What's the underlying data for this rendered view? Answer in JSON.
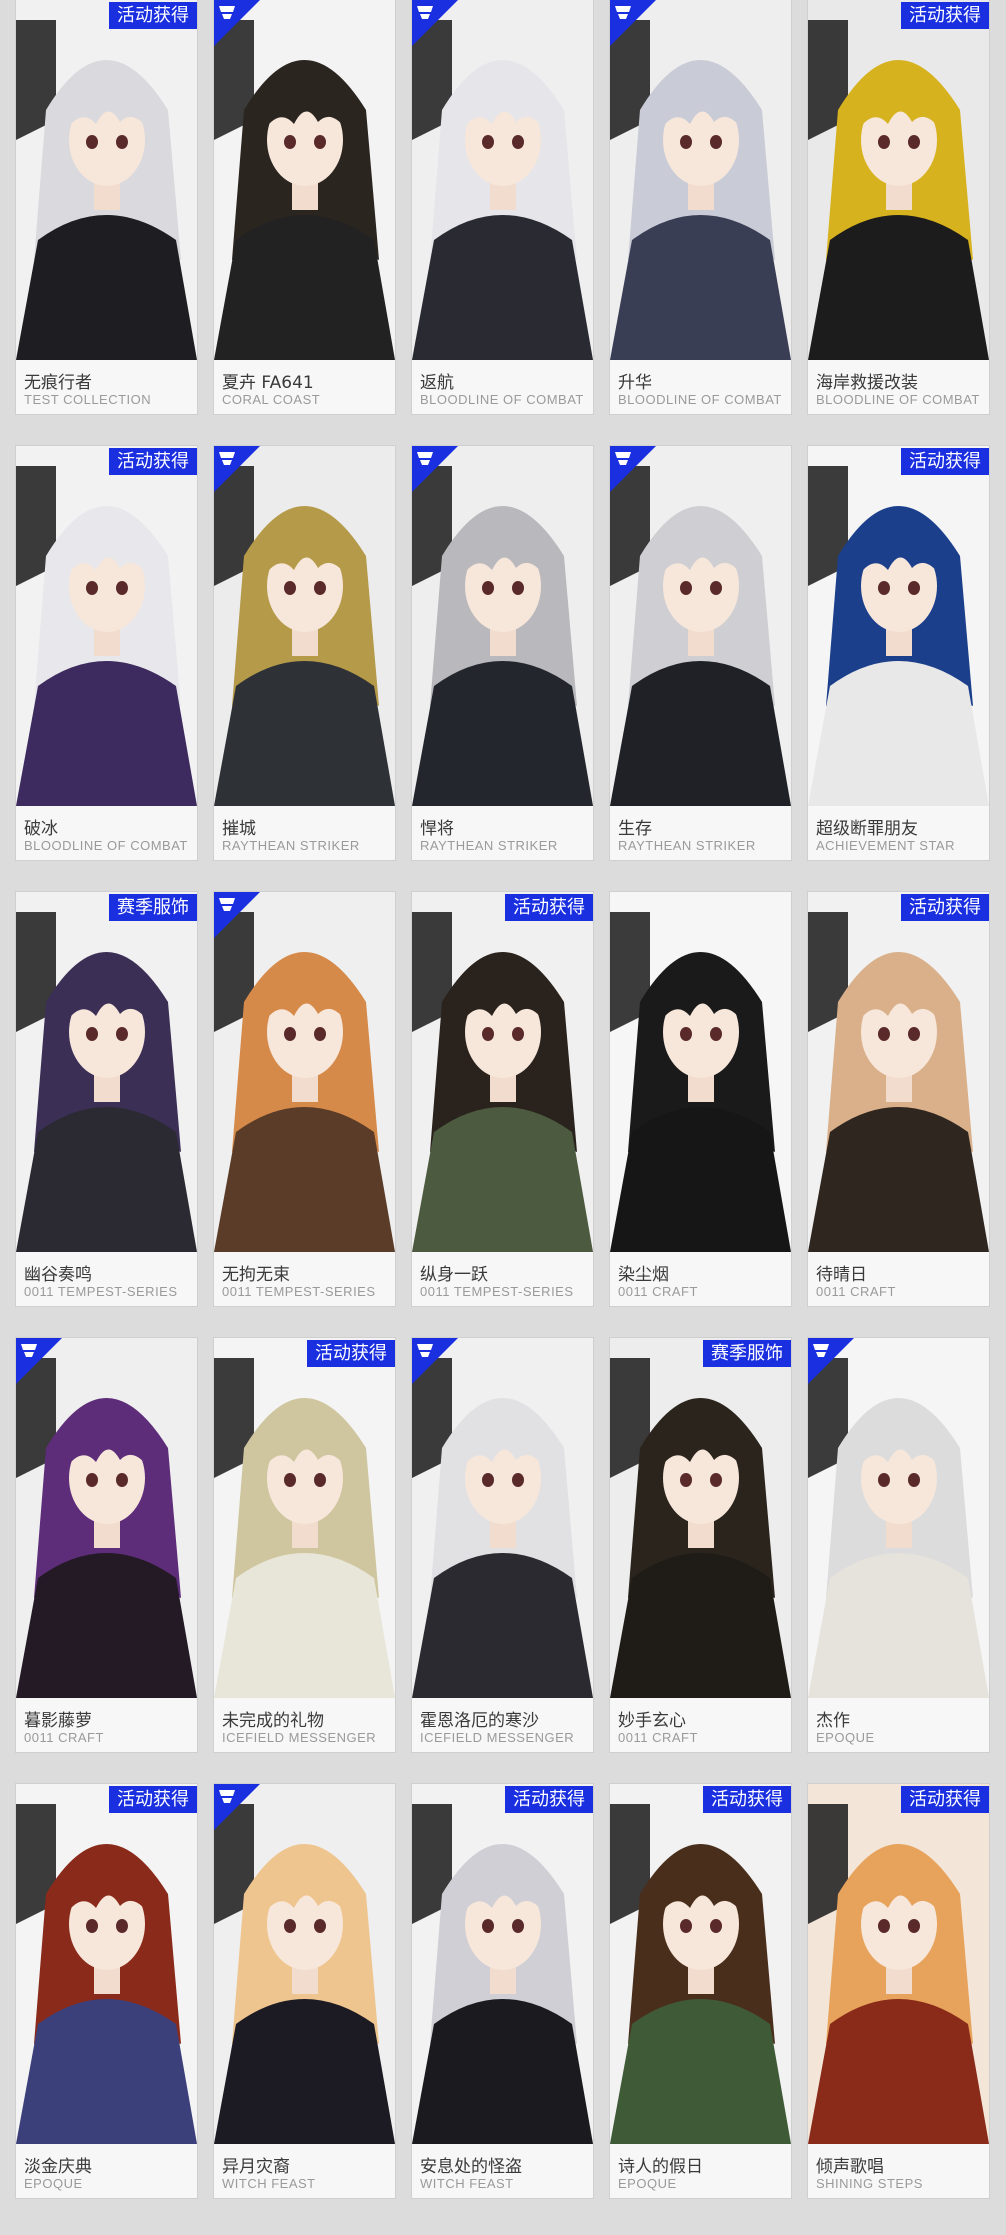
{
  "colors": {
    "badge": "#1a2fe0",
    "background": "#dcdcdc"
  },
  "cards": [
    {
      "name": "无痕行者",
      "series": "TEST COLLECTION",
      "badge": "活动获得",
      "corner": false,
      "tone": "#1e1e22",
      "hair": "#d9d9de",
      "bg": "#f1f1f1"
    },
    {
      "name": "夏卉 FA641",
      "series": "CORAL COAST",
      "badge": "",
      "corner": true,
      "tone": "#222",
      "hair": "#2b2520",
      "bg": "#f3f3f3"
    },
    {
      "name": "返航",
      "series": "BLOODLINE OF COMBAT",
      "badge": "",
      "corner": true,
      "tone": "#2a2a33",
      "hair": "#e6e6ea",
      "bg": "#efefef"
    },
    {
      "name": "升华",
      "series": "BLOODLINE OF COMBAT",
      "badge": "",
      "corner": true,
      "tone": "#3a3e55",
      "hair": "#c9ccd6",
      "bg": "#eeeeee"
    },
    {
      "name": "海岸救援改装",
      "series": "BLOODLINE OF COMBAT",
      "badge": "活动获得",
      "corner": false,
      "tone": "#1c1c1c",
      "hair": "#d7b21f",
      "bg": "#e9e9e9"
    },
    {
      "name": "破冰",
      "series": "BLOODLINE OF COMBAT",
      "badge": "活动获得",
      "corner": false,
      "tone": "#3d2a5e",
      "hair": "#e8e8ec",
      "bg": "#f2f2f2"
    },
    {
      "name": "摧城",
      "series": "RAYTHEAN STRIKER",
      "badge": "",
      "corner": true,
      "tone": "#2e3135",
      "hair": "#b59a4a",
      "bg": "#ececec"
    },
    {
      "name": "悍将",
      "series": "RAYTHEAN STRIKER",
      "badge": "",
      "corner": true,
      "tone": "#24262e",
      "hair": "#b9b9bd",
      "bg": "#eeeeee"
    },
    {
      "name": "生存",
      "series": "RAYTHEAN STRIKER",
      "badge": "",
      "corner": true,
      "tone": "#1f2126",
      "hair": "#cfcfd3",
      "bg": "#efefef"
    },
    {
      "name": "超级断罪朋友",
      "series": "ACHIEVEMENT STAR",
      "badge": "活动获得",
      "corner": false,
      "tone": "#e8e8e8",
      "hair": "#1c3f8c",
      "bg": "#f5f5f5"
    },
    {
      "name": "幽谷奏鸣",
      "series": "0011 TEMPEST-SERIES",
      "badge": "赛季服饰",
      "corner": false,
      "tone": "#2b2a33",
      "hair": "#3b2f55",
      "bg": "#f1f1f1"
    },
    {
      "name": "无拘无束",
      "series": "0011 TEMPEST-SERIES",
      "badge": "",
      "corner": true,
      "tone": "#5a3c28",
      "hair": "#d68a4a",
      "bg": "#efefef"
    },
    {
      "name": "纵身一跃",
      "series": "0011 TEMPEST-SERIES",
      "badge": "活动获得",
      "corner": false,
      "tone": "#4c5a3f",
      "hair": "#2a221c",
      "bg": "#f0f0f0"
    },
    {
      "name": "染尘烟",
      "series": "0011 CRAFT",
      "badge": "",
      "corner": false,
      "tone": "#161616",
      "hair": "#1a1a1a",
      "bg": "#f6f6f6"
    },
    {
      "name": "待晴日",
      "series": "0011 CRAFT",
      "badge": "活动获得",
      "corner": false,
      "tone": "#2f2620",
      "hair": "#d9b08a",
      "bg": "#f1f1f1"
    },
    {
      "name": "暮影藤萝",
      "series": "0011 CRAFT",
      "badge": "",
      "corner": true,
      "tone": "#231a26",
      "hair": "#5e2d7a",
      "bg": "#efefef"
    },
    {
      "name": "未完成的礼物",
      "series": "ICEFIELD MESSENGER",
      "badge": "活动获得",
      "corner": false,
      "tone": "#e8e6d8",
      "hair": "#cfc6a0",
      "bg": "#f4f4f4"
    },
    {
      "name": "霍恩洛厄的寒沙",
      "series": "ICEFIELD MESSENGER",
      "badge": "",
      "corner": true,
      "tone": "#2a2a30",
      "hair": "#e1e1e4",
      "bg": "#f0f0f0"
    },
    {
      "name": "妙手玄心",
      "series": "0011 CRAFT",
      "badge": "赛季服饰",
      "corner": false,
      "tone": "#1f1c18",
      "hair": "#2a241c",
      "bg": "#ededed"
    },
    {
      "name": "杰作",
      "series": "EPOQUE",
      "badge": "",
      "corner": true,
      "tone": "#e6e2dc",
      "hair": "#dcdcdc",
      "bg": "#f5f5f5"
    },
    {
      "name": "淡金庆典",
      "series": "EPOQUE",
      "badge": "活动获得",
      "corner": false,
      "tone": "#3b3f7a",
      "hair": "#8a2a1a",
      "bg": "#f4f4f4"
    },
    {
      "name": "异月灾裔",
      "series": "WITCH FEAST",
      "badge": "",
      "corner": true,
      "tone": "#1c1a22",
      "hair": "#efc58f",
      "bg": "#efefef"
    },
    {
      "name": "安息处的怪盗",
      "series": "WITCH FEAST",
      "badge": "活动获得",
      "corner": false,
      "tone": "#1b1b1f",
      "hair": "#cfcfd5",
      "bg": "#f2f2f2"
    },
    {
      "name": "诗人的假日",
      "series": "EPOQUE",
      "badge": "活动获得",
      "corner": false,
      "tone": "#3f5a37",
      "hair": "#4a2e1c",
      "bg": "#f2f2f2"
    },
    {
      "name": "倾声歌唱",
      "series": "SHINING STEPS",
      "badge": "活动获得",
      "corner": false,
      "tone": "#8a2a18",
      "hair": "#e7a35c",
      "bg": "#f3e6d9"
    }
  ]
}
